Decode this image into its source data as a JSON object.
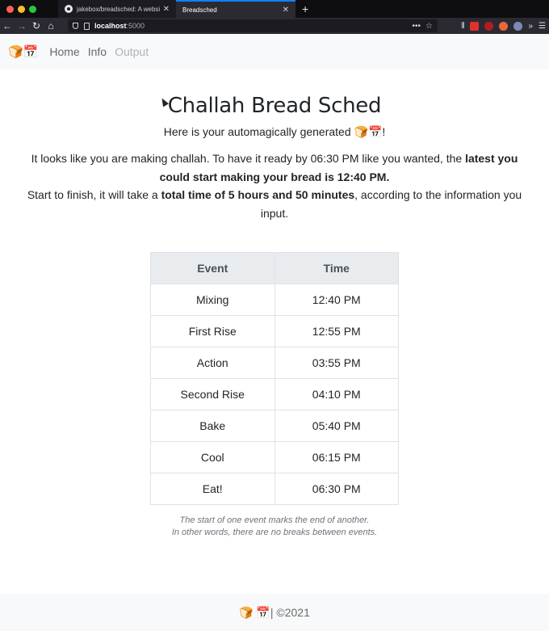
{
  "browser": {
    "tabs": [
      {
        "label": "jakebox/breadsched: A website",
        "active": false
      },
      {
        "label": "Breadsched",
        "active": true
      }
    ],
    "new_tab": "+",
    "close": "✕",
    "url_host": "localhost",
    "url_port": ":5000",
    "url_menu": "•••",
    "bookmark": "☆"
  },
  "site_nav": {
    "brand": "🍞📅",
    "links": [
      "Home",
      "Info",
      "Output"
    ]
  },
  "main": {
    "title": "Challah Bread Sched",
    "subtitle_text": "Here is your automagically generated ",
    "subtitle_emoji": "🍞📅",
    "subtitle_end": "!",
    "para1_a": "It looks like you are making challah. To have it ready by 06:30 PM like you wanted, the ",
    "para1_b": "latest you could start making your bread is 12:40 PM.",
    "para2_a": "Start to finish, it will take a ",
    "para2_b": "total time of 5 hours and 50 minutes",
    "para2_c": ", according to the information you input."
  },
  "table": {
    "headers": [
      "Event",
      "Time"
    ],
    "rows": [
      [
        "Mixing",
        "12:40 PM"
      ],
      [
        "First Rise",
        "12:55 PM"
      ],
      [
        "Action",
        "03:55 PM"
      ],
      [
        "Second Rise",
        "04:10 PM"
      ],
      [
        "Bake",
        "05:40 PM"
      ],
      [
        "Cool",
        "06:15 PM"
      ],
      [
        "Eat!",
        "06:30 PM"
      ]
    ]
  },
  "note": {
    "line1": "The start of one event marks the end of another.",
    "line2": "In other words, there are no breaks between events."
  },
  "footer": {
    "emoji": "🍞 📅",
    "text": " | ©2021"
  },
  "colors": {
    "accent_tab": "#0a84ff",
    "nav_bg": "#f8f9fa",
    "text": "#212529"
  }
}
